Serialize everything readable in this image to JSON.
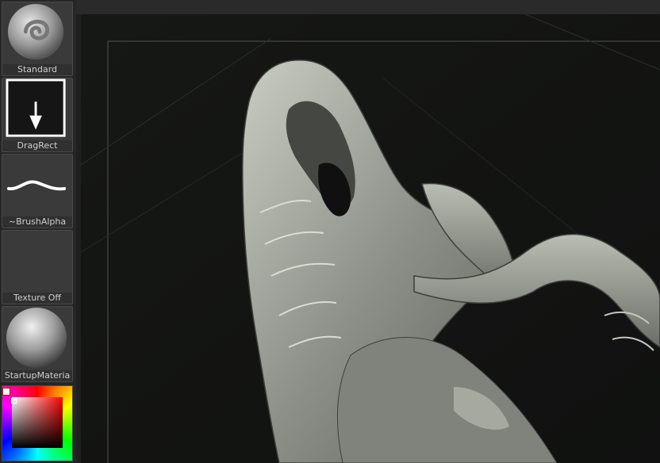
{
  "palette": {
    "standard_label": "Standard",
    "stroke_label": "DragRect",
    "alpha_label": "~BrushAlpha",
    "texture_label": "Texture Off",
    "material_label": "StartupMateria",
    "color_selector": "color-picker",
    "current_color": "#ffffff"
  },
  "canvas": {
    "background": "#141513",
    "model_color": "#9ea49b",
    "content": "sculpted-creature-model"
  },
  "icons": [
    "standard-brush-icon",
    "drag-rect-arrow-icon",
    "brush-alpha-stroke-icon",
    "material-sphere-icon"
  ]
}
